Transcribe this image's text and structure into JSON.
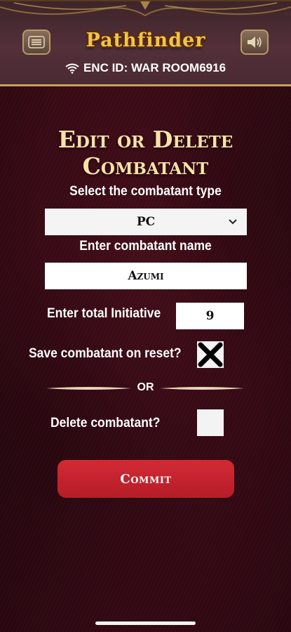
{
  "header": {
    "logo_text": "Pathfinder",
    "enc_label": "ENC ID: WAR ROOM6916",
    "menu_icon": "hamburger-menu-icon",
    "sound_icon": "speaker-icon",
    "wifi_icon": "wifi-icon"
  },
  "form": {
    "title_line1": "Edit or Delete",
    "title_line2": "Combatant",
    "type_label": "Select the combatant type",
    "type_value": "PC",
    "name_label": "Enter combatant name",
    "name_value": "Azumi",
    "initiative_label": "Enter total Initiative",
    "initiative_value": "9",
    "save_label": "Save combatant on reset?",
    "save_checked": true,
    "or_text": "OR",
    "delete_label": "Delete combatant?",
    "delete_checked": false,
    "commit_label": "Commit"
  },
  "colors": {
    "background": "#3a0a15",
    "accent_gold": "#c7a25a",
    "title_color": "#f8e2a8",
    "commit_red": "#c8222e"
  }
}
